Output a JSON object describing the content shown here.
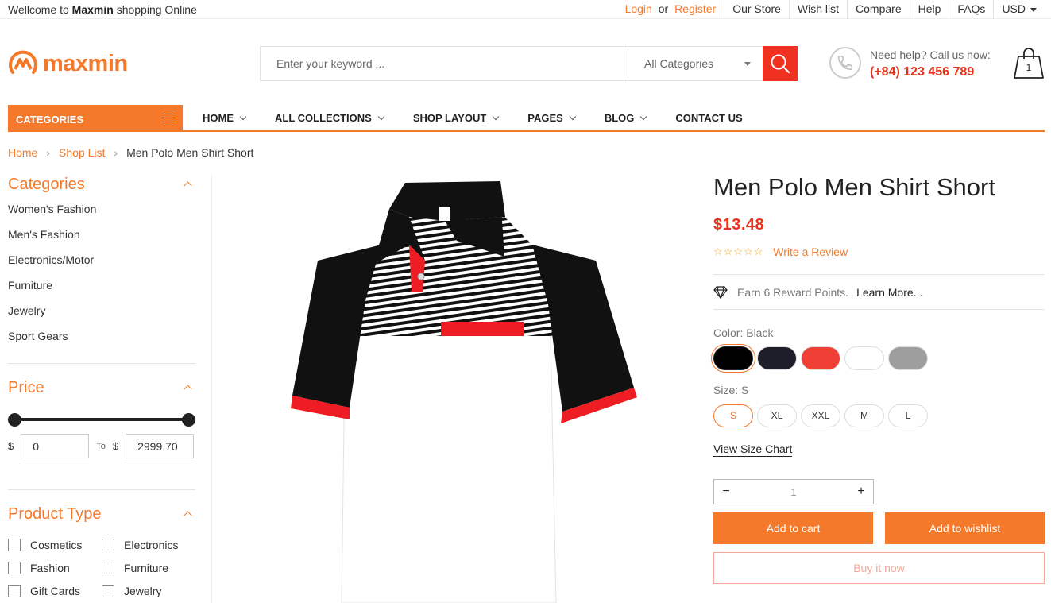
{
  "topbar": {
    "welcome_prefix": "Wellcome to",
    "welcome_brand": "Maxmin",
    "welcome_suffix": "shopping Online",
    "login": "Login",
    "or": "or",
    "register": "Register",
    "links": [
      "Our Store",
      "Wish list",
      "Compare",
      "Help",
      "FAQs"
    ],
    "currency": "USD"
  },
  "header": {
    "logo_text": "maxmin",
    "search_placeholder": "Enter your keyword ...",
    "category_select": "All Categories",
    "help_line1": "Need help? Call us now:",
    "help_phone": "(+84) 123 456 789",
    "cart_count": "1"
  },
  "nav": {
    "categories_label": "CATEGORIES",
    "items": [
      "HOME",
      "ALL COLLECTIONS",
      "SHOP LAYOUT",
      "PAGES",
      "BLOG",
      "CONTACT US"
    ]
  },
  "breadcrumb": [
    "Home",
    "Shop List",
    "Men Polo Men Shirt Short"
  ],
  "sidebar": {
    "categories_title": "Categories",
    "categories": [
      "Women's Fashion",
      "Men's Fashion",
      "Electronics/Motor",
      "Furniture",
      "Jewelry",
      "Sport Gears"
    ],
    "price_title": "Price",
    "currency_symbol": "$",
    "price_min": "0",
    "price_to": "To",
    "price_max": "2999.70",
    "product_type_title": "Product Type",
    "product_types": [
      "Cosmetics",
      "Electronics",
      "Fashion",
      "Furniture",
      "Gift Cards",
      "Jewelry"
    ]
  },
  "product": {
    "title": "Men Polo Men Shirt Short",
    "price": "$13.48",
    "stars": "☆☆☆☆☆",
    "write_review": "Write a Review",
    "reward_text": "Earn 6 Reward Points.",
    "learn_more": "Learn More...",
    "color_label": "Color: Black",
    "colors": [
      "#000000",
      "#1d1e29",
      "#ef3e33",
      "#ffffff",
      "#9e9e9e"
    ],
    "size_label": "Size: S",
    "sizes": [
      "S",
      "XL",
      "XXL",
      "M",
      "L"
    ],
    "size_chart": "View Size Chart",
    "quantity": "1",
    "minus": "−",
    "plus": "+",
    "add_to_cart": "Add to cart",
    "add_to_wishlist": "Add to wishlist",
    "buy_now": "Buy it now"
  },
  "colors": {
    "accent": "#f5792a",
    "price_red": "#e8331f",
    "search_red": "#f0311f"
  }
}
